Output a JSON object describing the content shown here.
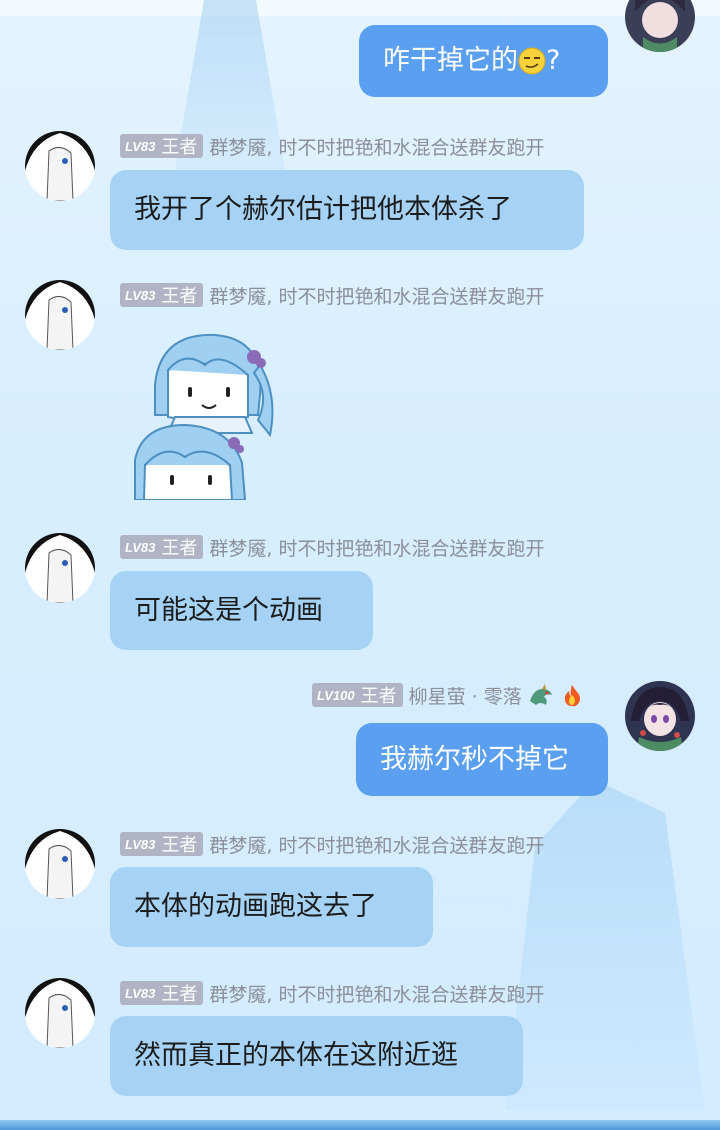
{
  "messages": [
    {
      "side": "self",
      "text": "咋干掉它的",
      "suffix": "?",
      "emoji": "smirk-face"
    },
    {
      "side": "other",
      "level": "LV83",
      "title": "王者",
      "sender": "群梦魇, 时不时把铯和水混合送群友跑开",
      "text": "我开了个赫尔估计把他本体杀了"
    },
    {
      "side": "other",
      "level": "LV83",
      "title": "王者",
      "sender": "群梦魇, 时不时把铯和水混合送群友跑开",
      "sticker": "blue-hair-chibi-sticker"
    },
    {
      "side": "other",
      "level": "LV83",
      "title": "王者",
      "sender": "群梦魇, 时不时把铯和水混合送群友跑开",
      "text": "可能这是个动画"
    },
    {
      "side": "self",
      "level": "LV100",
      "title": "王者",
      "sender": "柳星萤 · 零落",
      "sender_icons": [
        "dragon-icon",
        "fire-icon"
      ],
      "text": "我赫尔秒不掉它"
    },
    {
      "side": "other",
      "level": "LV83",
      "title": "王者",
      "sender": "群梦魇, 时不时把铯和水混合送群友跑开",
      "text": "本体的动画跑这去了"
    },
    {
      "side": "other",
      "level": "LV83",
      "title": "王者",
      "sender": "群梦魇, 时不时把铯和水混合送群友跑开",
      "text": "然而真正的本体在这附近逛"
    }
  ],
  "colors": {
    "background": "#dcefff",
    "other_bubble": "#a6d3f5",
    "self_bubble": "#5b9ff0",
    "badge": "#b0b4c4",
    "sender_text": "#8a8f98"
  }
}
